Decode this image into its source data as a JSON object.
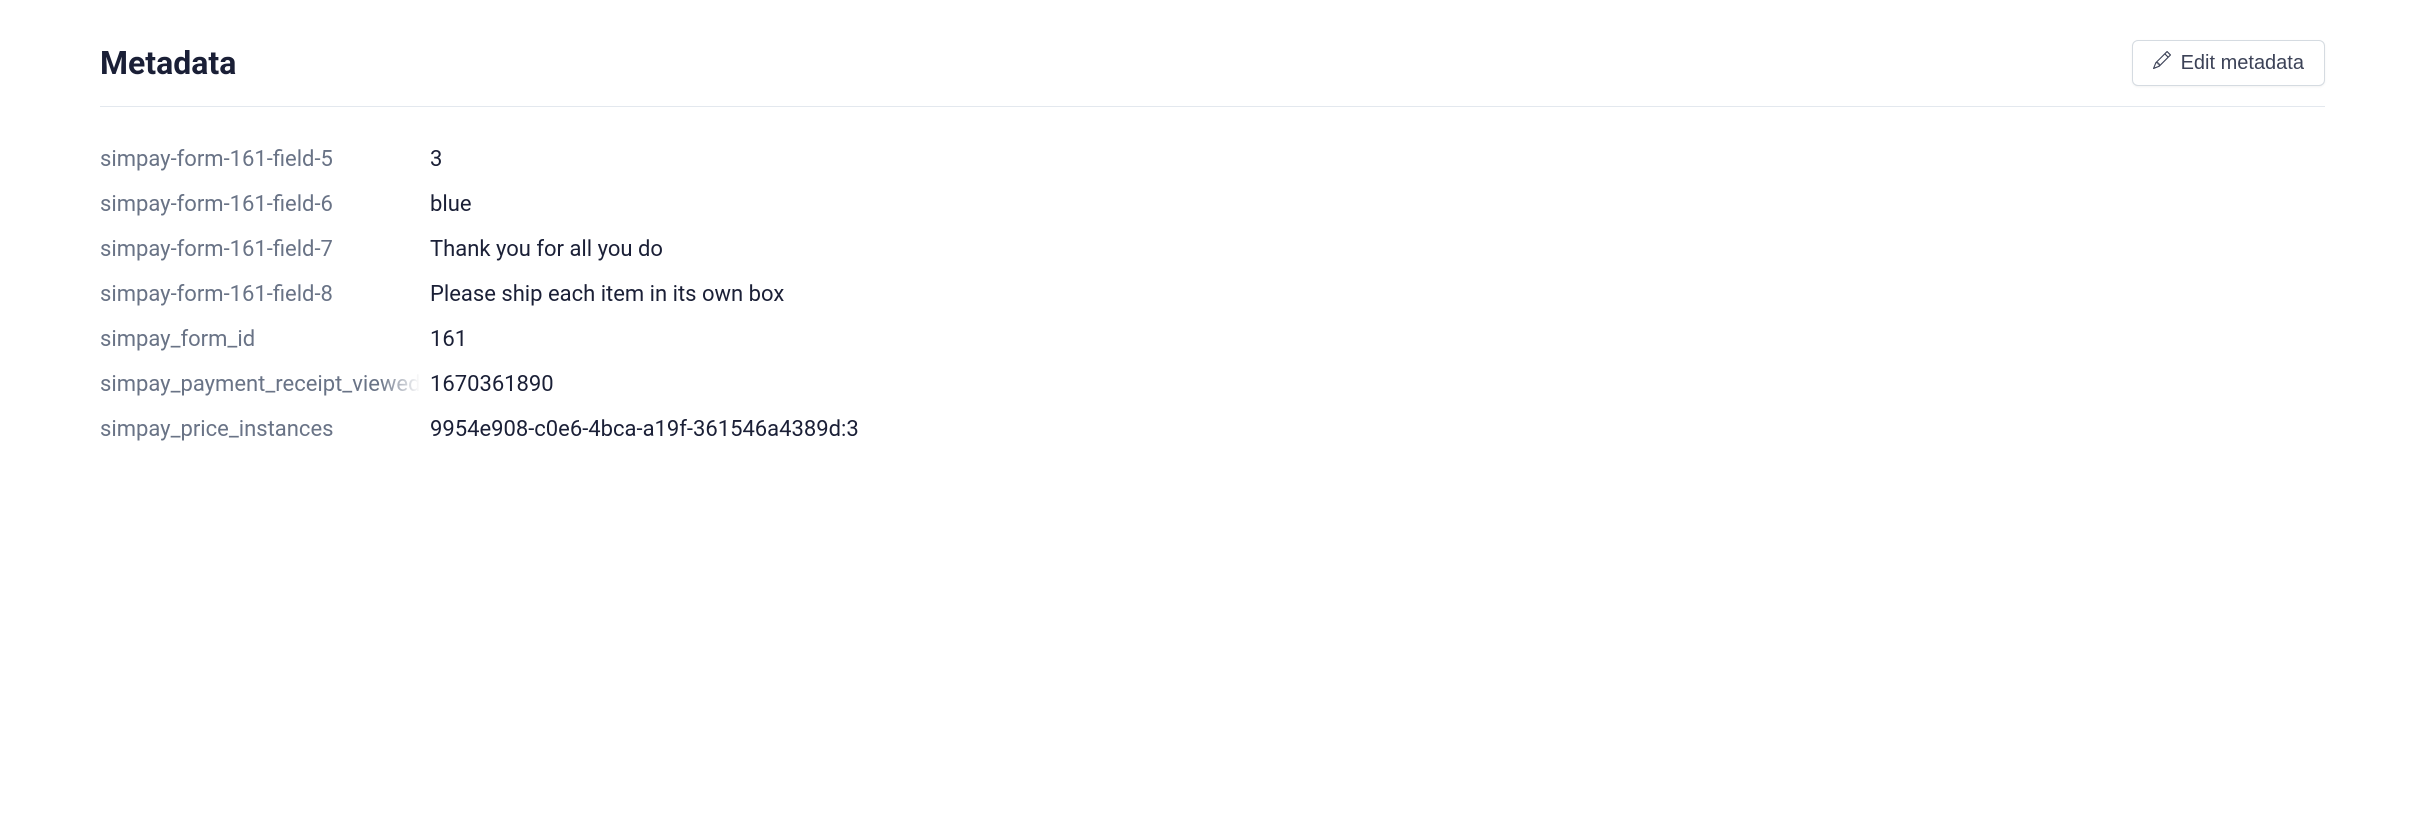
{
  "header": {
    "title": "Metadata",
    "edit_button_label": "Edit metadata"
  },
  "metadata": {
    "rows": [
      {
        "key": "simpay-form-161-field-5",
        "value": "3",
        "truncated": false
      },
      {
        "key": "simpay-form-161-field-6",
        "value": "blue",
        "truncated": false
      },
      {
        "key": "simpay-form-161-field-7",
        "value": "Thank you for all you do",
        "truncated": false
      },
      {
        "key": "simpay-form-161-field-8",
        "value": "Please ship each item in its own box",
        "truncated": false
      },
      {
        "key": "simpay_form_id",
        "value": "161",
        "truncated": false
      },
      {
        "key": "simpay_payment_receipt_viewed",
        "value": "1670361890",
        "truncated": true
      },
      {
        "key": "simpay_price_instances",
        "value": "9954e908-c0e6-4bca-a19f-361546a4389d:3",
        "truncated": false
      }
    ]
  }
}
